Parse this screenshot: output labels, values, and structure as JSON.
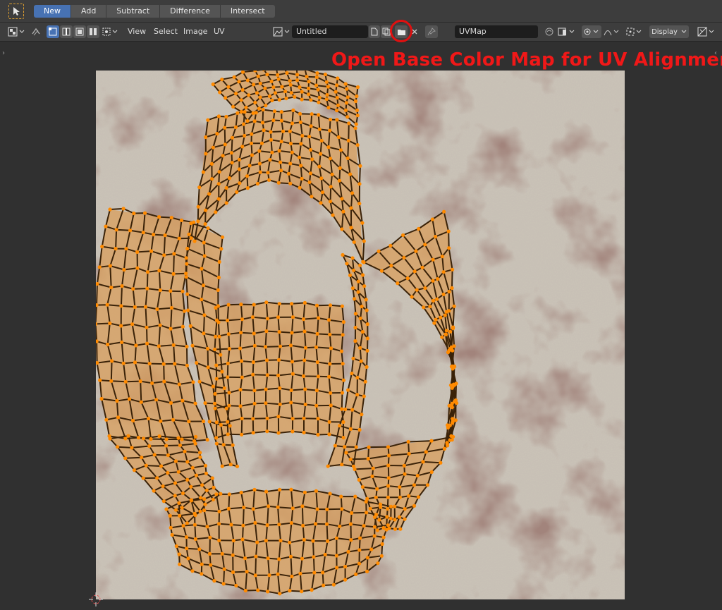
{
  "toolbar": {
    "modes": [
      {
        "label": "New",
        "active": true
      },
      {
        "label": "Add",
        "active": false
      },
      {
        "label": "Subtract",
        "active": false
      },
      {
        "label": "Difference",
        "active": false
      },
      {
        "label": "Intersect",
        "active": false
      }
    ]
  },
  "header": {
    "menus": [
      "View",
      "Select",
      "Image",
      "UV"
    ],
    "image_name": "Untitled",
    "uv_map": "UVMap",
    "display_label": "Display"
  },
  "annotation": {
    "text": "Open Base Color Map for UV Alignment",
    "color": "#f01818"
  },
  "colors": {
    "accent": "#4772b3",
    "uv_edge": "#3a2208",
    "uv_vertex": "#ff8a00",
    "uv_face": "#d9a060",
    "texture_base": "#c8c0b4",
    "texture_stain": "#6a4a40"
  },
  "icons": [
    "select-box-icon",
    "editor-type-icon",
    "sync-icon",
    "vertex-select-icon",
    "edge-select-icon",
    "face-select-icon",
    "island-select-icon",
    "pivot-icon",
    "image-browse-icon",
    "new-image-icon",
    "duplicate-icon",
    "open-image-folder-icon",
    "close-icon",
    "pin-icon",
    "sticky-select-icon",
    "uv-select-mode-icon",
    "proportional-icon",
    "falloff-icon",
    "snap-icon",
    "overlay-icon"
  ]
}
